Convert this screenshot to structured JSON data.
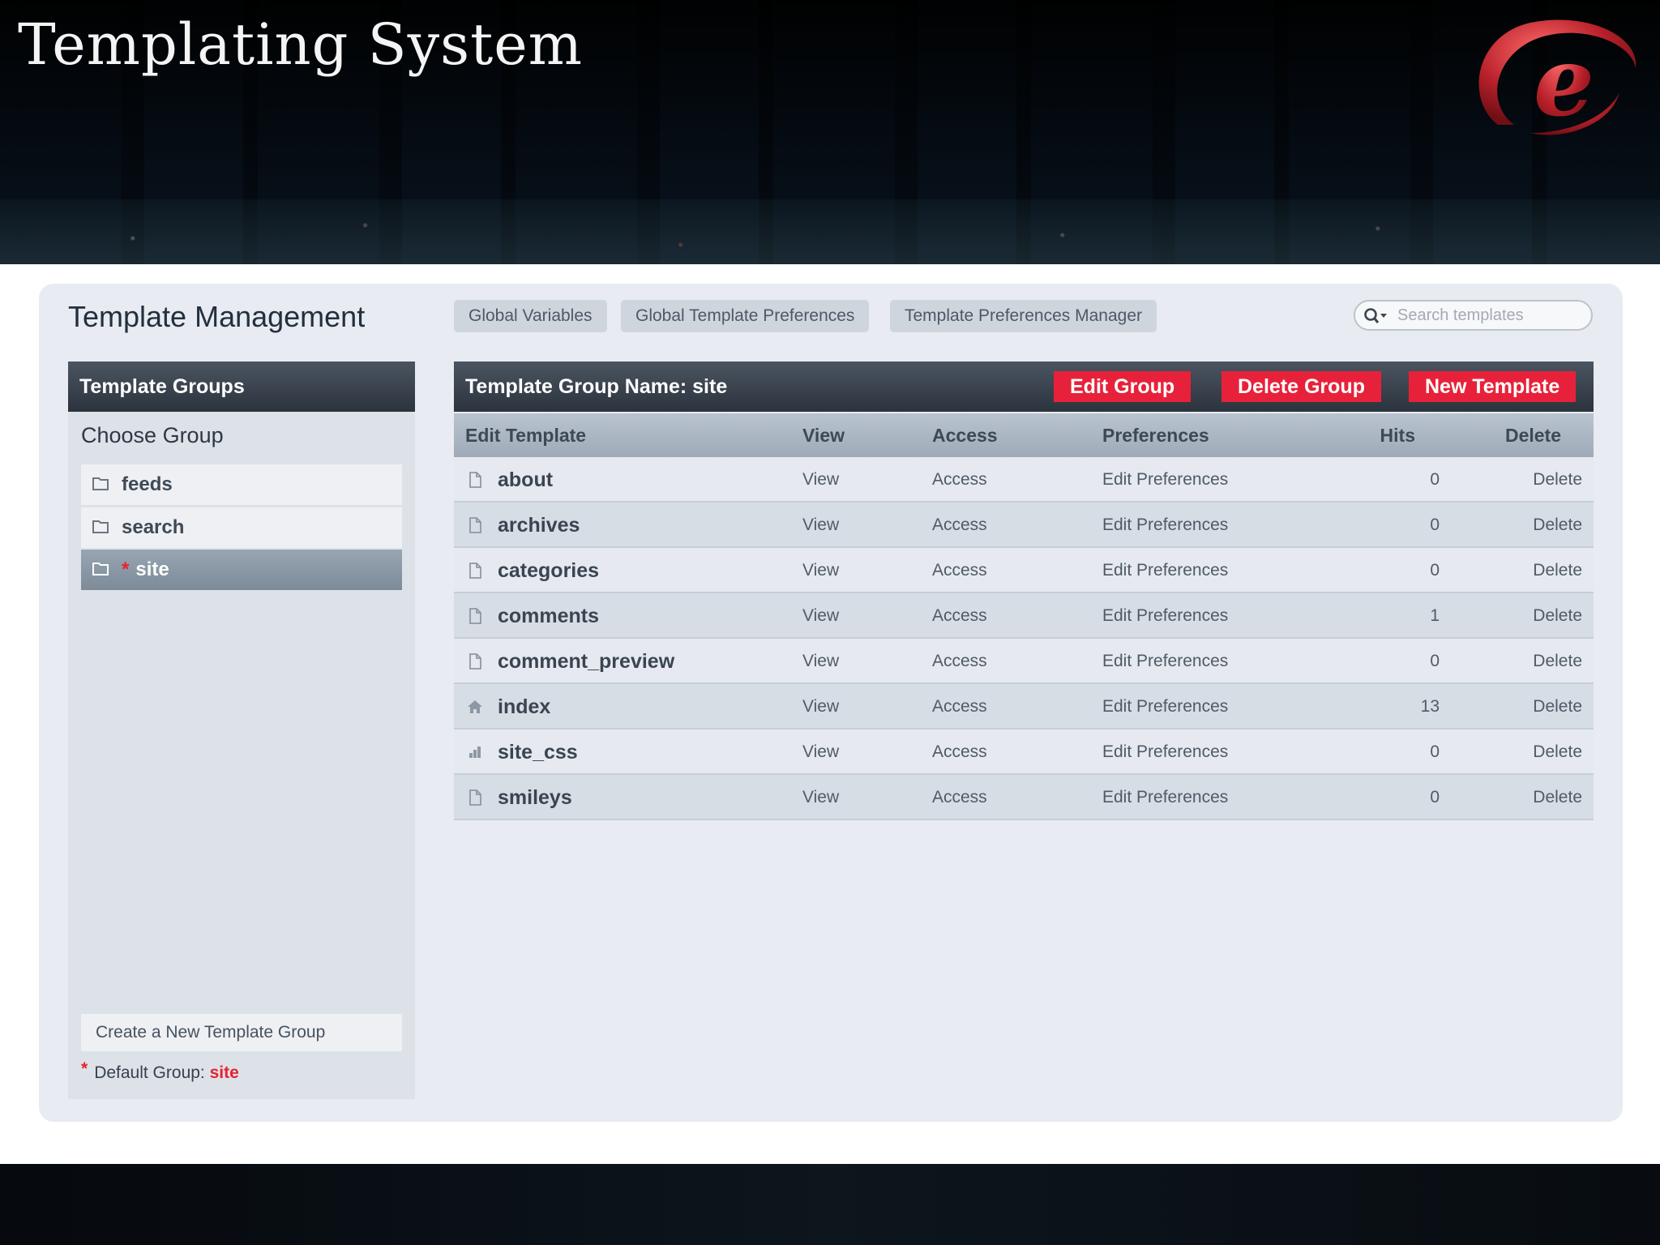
{
  "slide": {
    "title": "Templating System",
    "logo_icon": "expressionengine-e-logo-icon",
    "accent": "#e8213a"
  },
  "header": {
    "title": "Template Management",
    "tabs": [
      {
        "label": "Global Variables"
      },
      {
        "label": "Global Template Preferences"
      },
      {
        "label": "Template Preferences Manager"
      }
    ],
    "search": {
      "placeholder": "Search templates",
      "icon": "search-icon"
    }
  },
  "sidebar": {
    "heading": "Template Groups",
    "choose_label": "Choose Group",
    "groups": [
      {
        "name": "feeds",
        "is_default": false,
        "selected": false
      },
      {
        "name": "search",
        "is_default": false,
        "selected": false
      },
      {
        "name": "site",
        "is_default": true,
        "selected": true
      }
    ],
    "default_marker": "*",
    "create_label": "Create a New Template Group",
    "default_label": "Default Group:",
    "default_value": "site"
  },
  "main": {
    "title": "Template Group Name: site",
    "buttons": {
      "edit_group": "Edit Group",
      "delete_group": "Delete Group",
      "new_template": "New Template"
    },
    "columns": {
      "edit_template": "Edit Template",
      "view": "View",
      "access": "Access",
      "preferences": "Preferences",
      "hits": "Hits",
      "delete": "Delete"
    },
    "rows": [
      {
        "name": "about",
        "icon": "document-icon",
        "view": "View",
        "access": "Access",
        "preferences": "Edit Preferences",
        "hits": "0",
        "delete": "Delete"
      },
      {
        "name": "archives",
        "icon": "document-icon",
        "view": "View",
        "access": "Access",
        "preferences": "Edit Preferences",
        "hits": "0",
        "delete": "Delete"
      },
      {
        "name": "categories",
        "icon": "document-icon",
        "view": "View",
        "access": "Access",
        "preferences": "Edit Preferences",
        "hits": "0",
        "delete": "Delete"
      },
      {
        "name": "comments",
        "icon": "document-icon",
        "view": "View",
        "access": "Access",
        "preferences": "Edit Preferences",
        "hits": "1",
        "delete": "Delete"
      },
      {
        "name": "comment_preview",
        "icon": "document-icon",
        "view": "View",
        "access": "Access",
        "preferences": "Edit Preferences",
        "hits": "0",
        "delete": "Delete"
      },
      {
        "name": "index",
        "icon": "home-icon",
        "view": "View",
        "access": "Access",
        "preferences": "Edit Preferences",
        "hits": "13",
        "delete": "Delete"
      },
      {
        "name": "site_css",
        "icon": "css-file-icon",
        "view": "View",
        "access": "Access",
        "preferences": "Edit Preferences",
        "hits": "0",
        "delete": "Delete"
      },
      {
        "name": "smileys",
        "icon": "document-icon",
        "view": "View",
        "access": "Access",
        "preferences": "Edit Preferences",
        "hits": "0",
        "delete": "Delete"
      }
    ]
  }
}
